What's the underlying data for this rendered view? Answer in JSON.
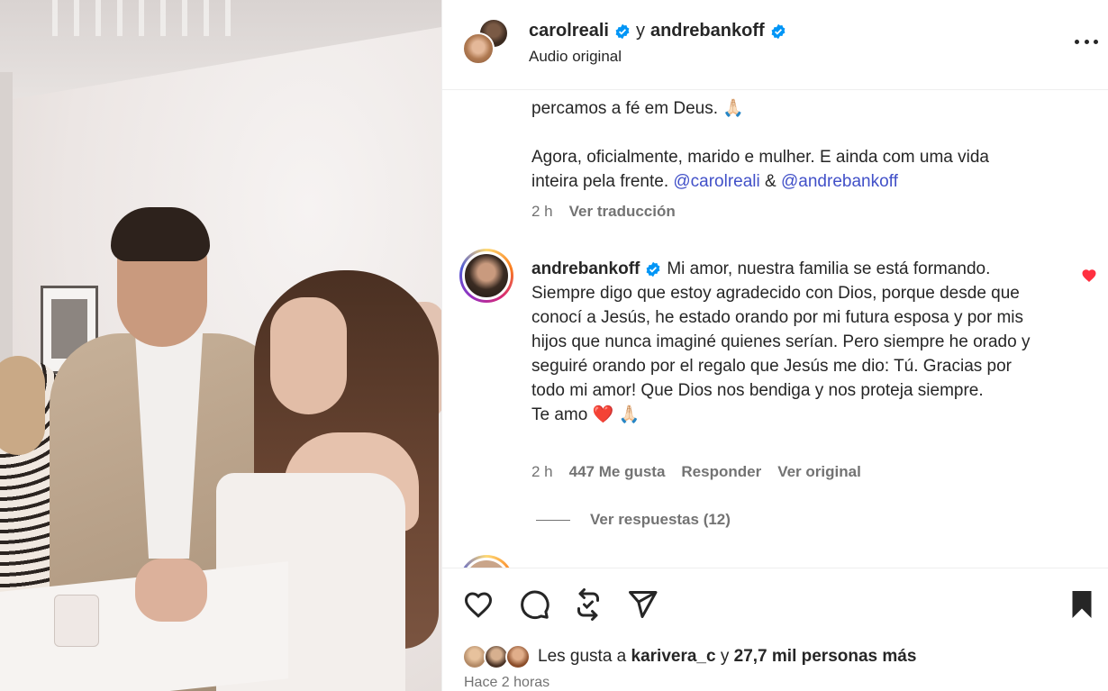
{
  "header": {
    "user1": "carolreali",
    "connector": "y",
    "user2": "andrebankoff",
    "audio": "Audio original"
  },
  "caption": {
    "line1": "percamos a fé em Deus.",
    "line1_emoji": "🙏🏻",
    "line2": "Agora, oficialmente, marido e mulher. E ainda com uma vida",
    "line3": "inteira pela frente.",
    "mention1": "@carolreali",
    "amp": "&",
    "mention2": "@andrebankoff",
    "time": "2 h",
    "translate": "Ver traducción"
  },
  "comment": {
    "user": "andrebankoff",
    "text": "Mi amor, nuestra familia se está formando. Siempre digo que estoy agradecido con Dios, porque desde que conocí a Jesús, he estado orando por mi futura esposa y por mis hijos que nunca imaginé quienes serían. Pero siempre he orado y seguiré orando por el regalo que Jesús me dio: Tú. Gracias por todo mi amor! Que Dios nos bendiga y nos proteja siempre.",
    "closing": "Te amo ❤️ 🙏🏻",
    "time": "2 h",
    "likes": "447 Me gusta",
    "reply": "Responder",
    "original": "Ver original",
    "view_replies": "Ver respuestas (12)",
    "liked": true
  },
  "likes": {
    "prefix": "Les gusta a",
    "user": "karivera_c",
    "connector": "y",
    "others": "27,7 mil personas más"
  },
  "posted": "Hace 2 horas",
  "icons": [
    "heart-icon",
    "comment-icon",
    "repost-icon",
    "share-icon",
    "bookmark-icon",
    "more-icon",
    "verified-icon"
  ],
  "colors": {
    "verified": "#0095f6",
    "mention": "#4150c8",
    "liked_heart": "#ff3040",
    "muted": "#737373"
  }
}
